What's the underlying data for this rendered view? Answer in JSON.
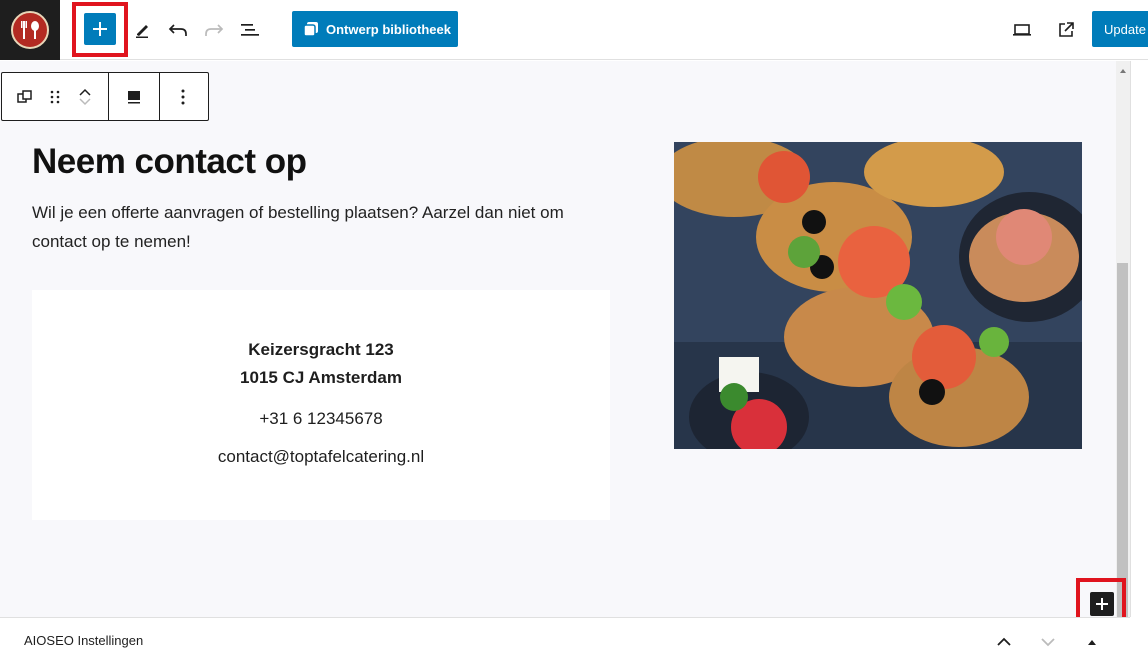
{
  "toolbar": {
    "library_label": "Ontwerp bibliotheek",
    "update_label": "Update"
  },
  "content": {
    "heading": "Neem contact op",
    "intro": "Wil je een offerte aanvragen of bestelling plaatsen? Aarzel dan niet om contact op te nemen!",
    "address_line1": "Keizersgracht 123",
    "address_line2": "1015 CJ Amsterdam",
    "phone": "+31 6 12345678",
    "email": "contact@toptafelcatering.nl"
  },
  "footer": {
    "panel_label": "AIOSEO Instellingen"
  },
  "colors": {
    "accent": "#007cba",
    "highlight": "#e0141e",
    "logo_red": "#b32a22"
  },
  "icons": {
    "toolbar": [
      "add-block-icon",
      "pencil-icon",
      "undo-icon",
      "redo-icon",
      "list-view-icon",
      "pattern-library-icon",
      "desktop-preview-icon",
      "external-link-icon"
    ],
    "block_toolbar": [
      "transform-icon",
      "drag-handle-icon",
      "chevron-up-icon",
      "chevron-down-icon",
      "align-icon",
      "more-options-icon"
    ],
    "footer": [
      "chevron-up-icon",
      "chevron-down-icon",
      "triangle-up-icon"
    ]
  }
}
